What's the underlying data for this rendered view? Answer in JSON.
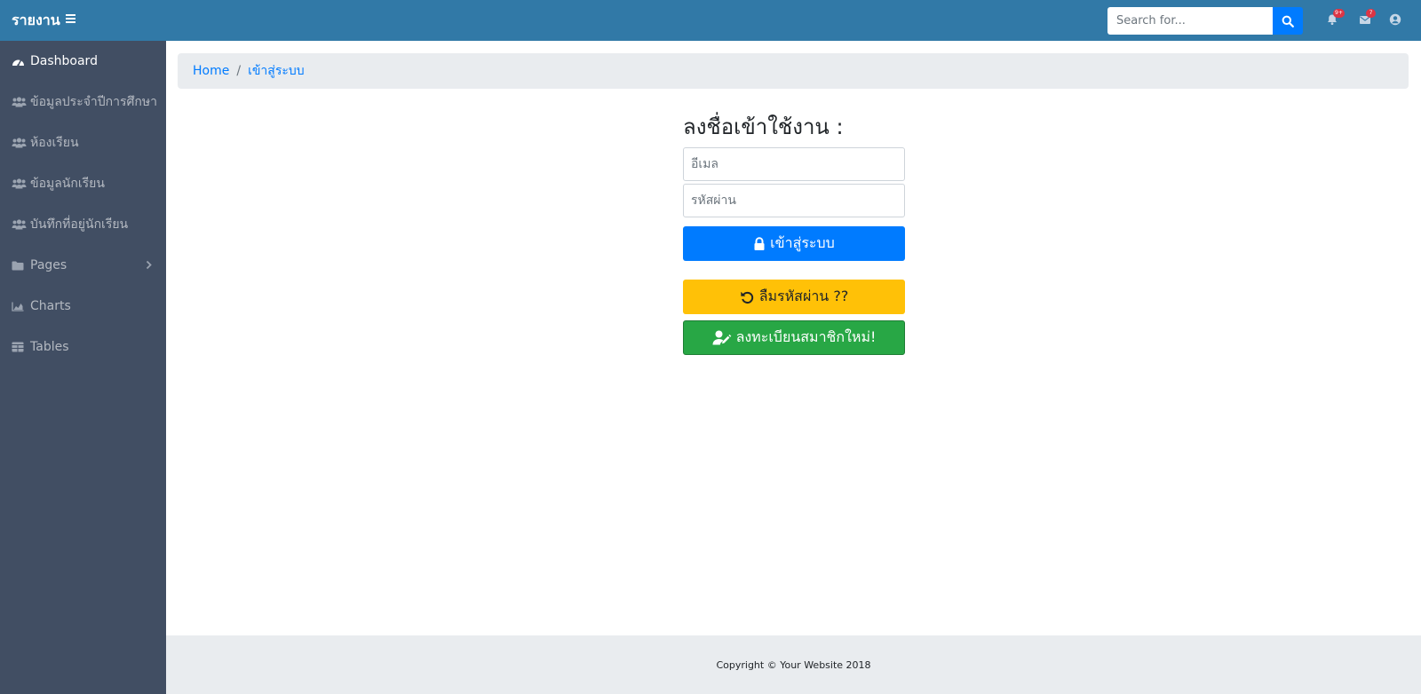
{
  "navbar": {
    "brand": "รายงาน",
    "search_placeholder": "Search for...",
    "alerts_badge": "9+",
    "messages_badge": "7"
  },
  "sidebar": {
    "items": [
      {
        "label": "Dashboard",
        "icon": "tachometer-icon"
      },
      {
        "label": "ข้อมูลประจำปีการศึกษา",
        "icon": "users-icon"
      },
      {
        "label": "ห้องเรียน",
        "icon": "users-icon"
      },
      {
        "label": "ข้อมูลนักเรียน",
        "icon": "users-icon"
      },
      {
        "label": "บันทึกที่อยู่นักเรียน",
        "icon": "users-icon"
      },
      {
        "label": "Pages",
        "icon": "folder-icon"
      },
      {
        "label": "Charts",
        "icon": "area-chart-icon"
      },
      {
        "label": "Tables",
        "icon": "table-icon"
      }
    ]
  },
  "breadcrumb": {
    "home": "Home",
    "current": "เข้าสู่ระบบ"
  },
  "login": {
    "title": "ลงชื่อเข้าใช้งาน :",
    "email_placeholder": "อีเมล",
    "password_placeholder": "รหัสผ่าน",
    "login_label": "เข้าสู่ระบบ",
    "forgot_label": "ลืมรหัสผ่าน ??",
    "register_label": "ลงทะเบียนสมาชิกใหม่!"
  },
  "footer": {
    "copyright": "Copyright © Your Website 2018"
  },
  "colors": {
    "navbar": "#3179a7",
    "sidebar": "#414e63",
    "primary": "#007bff",
    "warning": "#ffc107",
    "success": "#28a745",
    "badge": "#dc3545"
  }
}
